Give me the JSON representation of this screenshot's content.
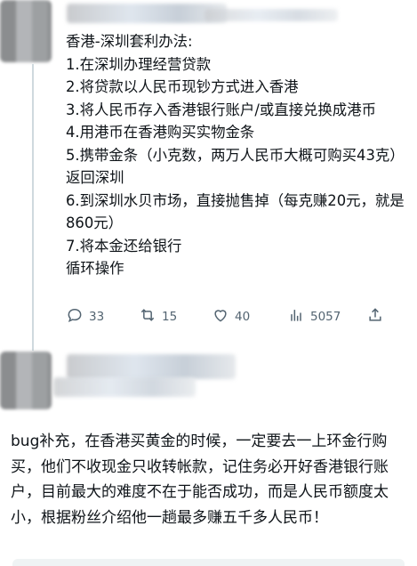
{
  "tweet": {
    "text": "香港-深圳套利办法:\n1.在深圳办理经营贷款\n2.将贷款以人民币现钞方式进入香港\n3.将人民币存入香港银行账户/或直接兑换成港币\n4.用港币在香港购买实物金条\n5.携带金条（小克数，两万人民币大概可购买43克）返回深圳\n6.到深圳水贝市场，直接抛售掉（每克赚20元，就是860元）\n7.将本金还给银行\n循环操作",
    "actions": {
      "reply_count": "33",
      "retweet_count": "15",
      "like_count": "40",
      "views_count": "5057"
    },
    "icons": [
      "reply-icon",
      "retweet-icon",
      "like-icon",
      "views-icon",
      "share-icon"
    ]
  },
  "caption": {
    "text": "bug补充，在香港买黄金的时候，一定要去一上环金行购买，他们不收现金只收转帐款，记住务必开好香港银行账户，目前最大的难度不在于能否成功，而是人民币额度太小，根据粉丝介绍他一趟最多赚五千多人民币！"
  },
  "colors": {
    "text": "#0f1419",
    "muted": "#536471",
    "line": "#cfd9de"
  }
}
